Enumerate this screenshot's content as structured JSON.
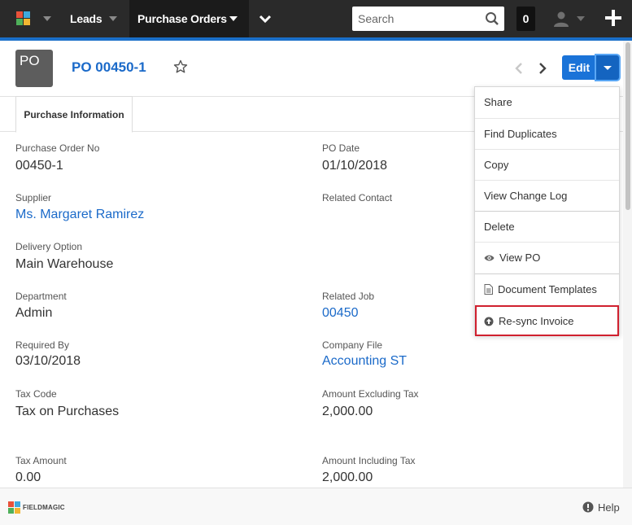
{
  "nav": {
    "tabs": [
      {
        "label": "Leads",
        "active": false
      },
      {
        "label": "Purchase Orders",
        "active": true
      }
    ],
    "search_placeholder": "Search",
    "notification_count": "0",
    "icons": {
      "logo": "app-logo-icon",
      "more": "chevron-down-icon",
      "search": "search-icon",
      "user": "user-icon",
      "add": "plus-icon"
    }
  },
  "record": {
    "avatar_text": "PO",
    "title": "PO 00450-1",
    "favorite_icon": "star-outline-icon"
  },
  "actions": {
    "edit_label": "Edit",
    "menu": [
      {
        "label": "Share",
        "icon": ""
      },
      {
        "label": "Find Duplicates",
        "icon": ""
      },
      {
        "label": "Copy",
        "icon": ""
      },
      {
        "label": "View Change Log",
        "icon": ""
      },
      {
        "label": "Delete",
        "icon": ""
      },
      {
        "label": "View PO",
        "icon": "eye-icon"
      },
      {
        "label": "Document Templates",
        "icon": "document-icon"
      },
      {
        "label": "Re-sync Invoice",
        "icon": "upload-circle-icon",
        "highlighted": true
      }
    ]
  },
  "tabs": {
    "active": "Purchase Information"
  },
  "fields": {
    "purchase_order_no": {
      "label": "Purchase Order No",
      "value": "00450-1"
    },
    "po_date": {
      "label": "PO Date",
      "value": "01/10/2018"
    },
    "supplier": {
      "label": "Supplier",
      "value": "Ms. Margaret Ramirez"
    },
    "related_contact": {
      "label": "Related Contact",
      "value": ""
    },
    "delivery_option": {
      "label": "Delivery Option",
      "value": "Main Warehouse"
    },
    "department": {
      "label": "Department",
      "value": "Admin"
    },
    "related_job": {
      "label": "Related Job",
      "value": "00450"
    },
    "required_by": {
      "label": "Required By",
      "value": "03/10/2018"
    },
    "company_file": {
      "label": "Company File",
      "value": "Accounting ST"
    },
    "tax_code": {
      "label": "Tax Code",
      "value": "Tax on Purchases"
    },
    "amount_excluding_tax": {
      "label": "Amount Excluding Tax",
      "value": "2,000.00"
    },
    "tax_amount": {
      "label": "Tax Amount",
      "value": "0.00"
    },
    "amount_including_tax": {
      "label": "Amount Including Tax",
      "value": "2,000.00"
    }
  },
  "footer": {
    "logo_text": "FIELDMAGIC",
    "help_label": "Help"
  },
  "colors": {
    "nav_bg": "#2a2a2a",
    "accent": "#1a73d8",
    "link": "#1b6ac9",
    "highlight_border": "#d0202f"
  }
}
